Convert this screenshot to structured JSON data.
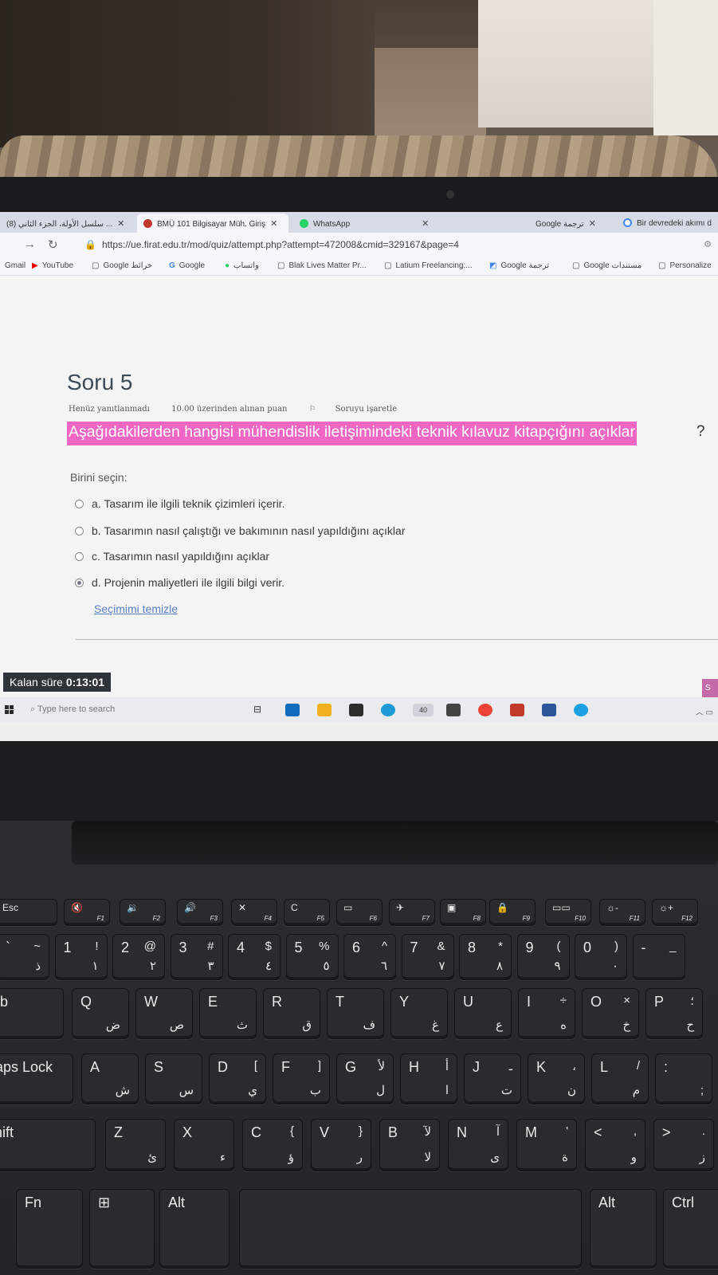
{
  "browser": {
    "tabs": [
      {
        "label": "سلسل الأولة، الجزء الثاني (8) ...",
        "active": false
      },
      {
        "label": "BMÜ 101 Bilgisayar Müh. Giriş",
        "active": true
      },
      {
        "label": "WhatsApp",
        "active": false
      },
      {
        "label": "Google ترجمة",
        "active": false
      },
      {
        "label": "Bir devredeki akımı d",
        "active": false
      }
    ],
    "url": "https://ue.firat.edu.tr/mod/quiz/attempt.php?attempt=472008&cmid=329167&page=4",
    "bookmarks": [
      "Gmail",
      "YouTube",
      "Google خرائط",
      "Google",
      "واتساب",
      "Blak Lives Matter Pr...",
      "Latium Freelancing:...",
      "Google ترجمة",
      "Google مستندات",
      "Personalize"
    ]
  },
  "quiz": {
    "title": "Soru 5",
    "status": "Henüz yanıtlanmadı",
    "points": "10.00 üzerinden alınan puan",
    "flag": "Soruyu işaretle",
    "question": "Aşağıdakilerden hangisi mühendislik iletişimindeki teknik kılavuz kitapçığını açıklar",
    "question_mark": "?",
    "choose_label": "Birini seçin:",
    "options": [
      {
        "label": "a. Tasarım ile ilgili teknik çizimleri içerir.",
        "selected": false
      },
      {
        "label": "b. Tasarımın nasıl çalıştığı ve bakımının nasıl yapıldığını açıklar",
        "selected": false
      },
      {
        "label": "c. Tasarımın nasıl yapıldığını açıklar",
        "selected": false
      },
      {
        "label": "d. Projenin maliyetleri ile ilgili bilgi verir.",
        "selected": true
      }
    ],
    "clear_label": "Seçimimi temizle",
    "timer_label": "Kalan süre",
    "timer_value": "0:13:01",
    "side_tab": "S"
  },
  "taskbar": {
    "search_placeholder": "Type here to search",
    "mail_badge": "40"
  },
  "keyboard": {
    "fn_row": [
      {
        "p": "Esc"
      },
      {
        "p": "🔇",
        "f": "F1"
      },
      {
        "p": "🔉",
        "f": "F2"
      },
      {
        "p": "🔊",
        "f": "F3"
      },
      {
        "p": "✕",
        "f": "F4"
      },
      {
        "p": "C",
        "f": "F5"
      },
      {
        "p": "▭",
        "f": "F6"
      },
      {
        "p": "✈",
        "f": "F7"
      },
      {
        "p": "▣",
        "f": "F8"
      },
      {
        "p": "🔒",
        "f": "F9"
      },
      {
        "p": "▭▭",
        "f": "F10"
      },
      {
        "p": "☼-",
        "f": "F11"
      },
      {
        "p": "☼+",
        "f": "F12"
      }
    ],
    "num_row": [
      {
        "s": "~",
        "p": "`",
        "a": "ذ"
      },
      {
        "s": "!",
        "p": "1",
        "a": "١"
      },
      {
        "s": "@",
        "p": "2",
        "a": "٢"
      },
      {
        "s": "#",
        "p": "3",
        "a": "٣"
      },
      {
        "s": "$",
        "p": "4",
        "a": "٤"
      },
      {
        "s": "%",
        "p": "5",
        "a": "٥"
      },
      {
        "s": "^",
        "p": "6",
        "a": "٦"
      },
      {
        "s": "&",
        "p": "7",
        "a": "٧"
      },
      {
        "s": "*",
        "p": "8",
        "a": "٨"
      },
      {
        "s": "(",
        "p": "9",
        "a": "٩"
      },
      {
        "s": ")",
        "p": "0",
        "a": "٠"
      },
      {
        "s": "_",
        "p": "-",
        "a": ""
      }
    ],
    "q_row": [
      {
        "p": "Tab"
      },
      {
        "p": "Q",
        "a": "ض"
      },
      {
        "p": "W",
        "a": "ص"
      },
      {
        "p": "E",
        "a": "ث"
      },
      {
        "p": "R",
        "a": "ق"
      },
      {
        "p": "T",
        "a": "ف"
      },
      {
        "p": "Y",
        "a": "غ"
      },
      {
        "p": "U",
        "a": "ع"
      },
      {
        "p": "I",
        "s": "÷",
        "a": "ه"
      },
      {
        "p": "O",
        "s": "×",
        "a": "خ"
      },
      {
        "p": "P",
        "s": "؛",
        "a": "ح"
      }
    ],
    "a_row": [
      {
        "p": "Caps Lock"
      },
      {
        "p": "A",
        "a": "ش"
      },
      {
        "p": "S",
        "a": "س"
      },
      {
        "p": "D",
        "s": "[",
        "a": "ي"
      },
      {
        "p": "F",
        "s": "]",
        "a": "ب"
      },
      {
        "p": "G",
        "s": "لأ",
        "a": "ل"
      },
      {
        "p": "H",
        "s": "أ",
        "a": "ا"
      },
      {
        "p": "J",
        "s": "ـ",
        "a": "ت"
      },
      {
        "p": "K",
        "s": "،",
        "a": "ن"
      },
      {
        "p": "L",
        "s": "/",
        "a": "م"
      },
      {
        "p": ":",
        "a": ";"
      }
    ],
    "z_row": [
      {
        "p": "Shift"
      },
      {
        "p": "Z",
        "a": "ئ"
      },
      {
        "p": "X",
        "a": "ء"
      },
      {
        "p": "C",
        "s": "{",
        "a": "ؤ"
      },
      {
        "p": "V",
        "s": "}",
        "a": "ر"
      },
      {
        "p": "B",
        "s": "لآ",
        "a": "لا"
      },
      {
        "p": "N",
        "s": "آ",
        "a": "ى"
      },
      {
        "p": "M",
        "s": "'",
        "a": "ة"
      },
      {
        "p": "<",
        "s": ",",
        "a": "و"
      },
      {
        "p": ">",
        "s": ".",
        "a": "ز"
      }
    ],
    "bottom_row": [
      {
        "p": "Fn"
      },
      {
        "p": "⊞"
      },
      {
        "p": "Alt"
      },
      {
        "p": ""
      },
      {
        "p": "Alt"
      },
      {
        "p": "Ctrl"
      }
    ]
  },
  "colors": {
    "highlight": "#ef67c2",
    "link": "#5b7fc0",
    "timer_bg": "#2e3339"
  }
}
